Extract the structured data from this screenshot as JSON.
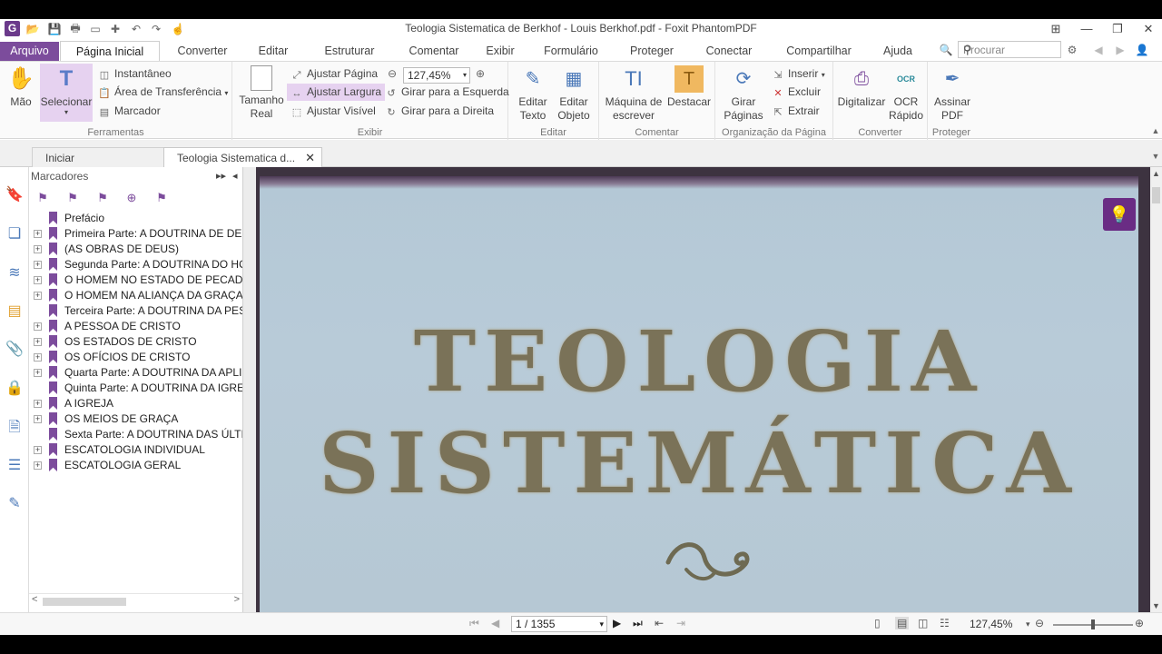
{
  "window": {
    "title": "Teologia Sistematica de Berkhof - Louis Berkhof.pdf - Foxit PhantomPDF"
  },
  "menu_tabs": [
    "Arquivo",
    "Página Inicial",
    "Converter",
    "Editar",
    "Estruturar",
    "Comentar",
    "Exibir",
    "Formulário",
    "Proteger",
    "Conectar",
    "Compartilhar",
    "Ajuda"
  ],
  "search": {
    "placeholder": "Procurar"
  },
  "ribbon": {
    "ferramentas": {
      "label": "Ferramentas",
      "mao": "Mão",
      "selecionar": "Selecionar",
      "instantaneo": "Instantâneo",
      "area": "Área de Transferência",
      "marcador": "Marcador"
    },
    "exibir": {
      "label": "Exibir",
      "tamanho": "Tamanho",
      "real": "Real",
      "ajustar_pagina": "Ajustar Página",
      "ajustar_largura": "Ajustar Largura",
      "ajustar_visivel": "Ajustar Visível",
      "zoom": "127,45%",
      "girar_esq": "Girar para a Esquerda",
      "girar_dir": "Girar para a Direita"
    },
    "editar": {
      "label": "Editar",
      "editar": "Editar",
      "texto": "Texto",
      "editar2": "Editar",
      "objeto": "Objeto"
    },
    "comentar": {
      "label": "Comentar",
      "maquina": "Máquina de",
      "escrever": "escrever",
      "destacar": "Destacar"
    },
    "organizacao": {
      "label": "Organização da Página",
      "girar": "Girar",
      "paginas": "Páginas",
      "inserir": "Inserir",
      "excluir": "Excluir",
      "extrair": "Extrair"
    },
    "converter": {
      "label": "Converter",
      "digitalizar": "Digitalizar",
      "ocr": "OCR",
      "rapido": "Rápido"
    },
    "proteger": {
      "label": "Proteger",
      "assinar": "Assinar",
      "pdf": "PDF"
    }
  },
  "doc_tabs": {
    "start": "Iniciar",
    "current": "Teologia Sistematica d..."
  },
  "bookmarks": {
    "title": "Marcadores",
    "items": [
      {
        "label": "Prefácio",
        "expandable": false
      },
      {
        "label": "Primeira Parte: A DOUTRINA DE DEUS",
        "expandable": true
      },
      {
        "label": "(AS OBRAS DE DEUS)",
        "expandable": true
      },
      {
        "label": "Segunda Parte: A DOUTRINA DO HOM",
        "expandable": true
      },
      {
        "label": "O HOMEM NO ESTADO DE PECADO",
        "expandable": true
      },
      {
        "label": "O HOMEM NA ALIANÇA DA GRAÇA",
        "expandable": true
      },
      {
        "label": "Terceira Parte: A DOUTRINA DA PESS",
        "expandable": false
      },
      {
        "label": "A PESSOA DE CRISTO",
        "expandable": true
      },
      {
        "label": "OS ESTADOS DE CRISTO",
        "expandable": true
      },
      {
        "label": "OS OFÍCIOS DE CRISTO",
        "expandable": true
      },
      {
        "label": "Quarta Parte: A DOUTRINA DA APLIC",
        "expandable": true
      },
      {
        "label": "Quinta Parte: A DOUTRINA DA IGREJA",
        "expandable": false
      },
      {
        "label": "A IGREJA",
        "expandable": true
      },
      {
        "label": "OS MEIOS DE GRAÇA",
        "expandable": true
      },
      {
        "label": "Sexta Parte: A DOUTRINA DAS ÚLTIM",
        "expandable": false
      },
      {
        "label": "ESCATOLOGIA INDIVIDUAL",
        "expandable": true
      },
      {
        "label": "ESCATOLOGIA GERAL",
        "expandable": true
      }
    ]
  },
  "document": {
    "line1": "TEOLOGIA",
    "line2": "SISTEMÁTICA"
  },
  "status": {
    "page": "1 / 1355",
    "zoom": "127,45%"
  },
  "colors": {
    "accent": "#7c4c9c",
    "highlight": "#e6d2f0",
    "page_bg": "#b6c8d4",
    "title_text": "#7a7258"
  }
}
